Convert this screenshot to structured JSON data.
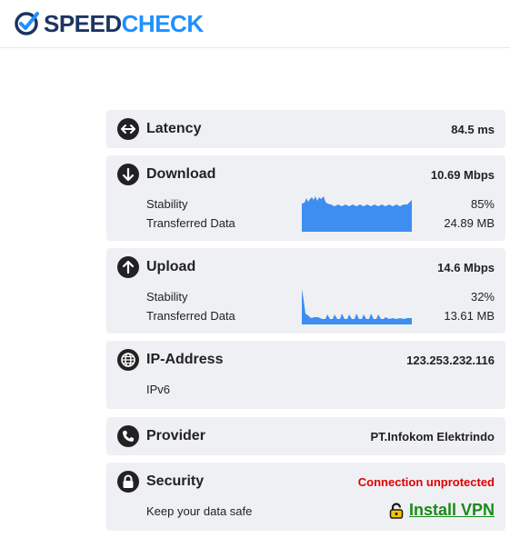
{
  "brand": {
    "part1": "SPEED",
    "part2": "CHECK"
  },
  "latency": {
    "title": "Latency",
    "value": "84.5 ms",
    "icon": "arrows-horizontal-icon"
  },
  "download": {
    "title": "Download",
    "value": "10.69 Mbps",
    "icon": "arrow-down-icon",
    "stability_label": "Stability",
    "stability_value": "85%",
    "transferred_label": "Transferred Data",
    "transferred_value": "24.89 MB",
    "graph_color": "#3d8ef0"
  },
  "upload": {
    "title": "Upload",
    "value": "14.6 Mbps",
    "icon": "arrow-up-icon",
    "stability_label": "Stability",
    "stability_value": "32%",
    "transferred_label": "Transferred Data",
    "transferred_value": "13.61 MB",
    "graph_color": "#3d8ef0"
  },
  "ip": {
    "title": "IP-Address",
    "value": "123.253.232.116",
    "version": "IPv6",
    "icon": "globe-icon"
  },
  "provider": {
    "title": "Provider",
    "value": "PT.Infokom Elektrindo",
    "icon": "phone-icon"
  },
  "security": {
    "title": "Security",
    "status": "Connection unprotected",
    "status_color": "#e00000",
    "subtitle": "Keep your data safe",
    "vpn_label": "Install VPN",
    "icon": "lock-icon"
  }
}
